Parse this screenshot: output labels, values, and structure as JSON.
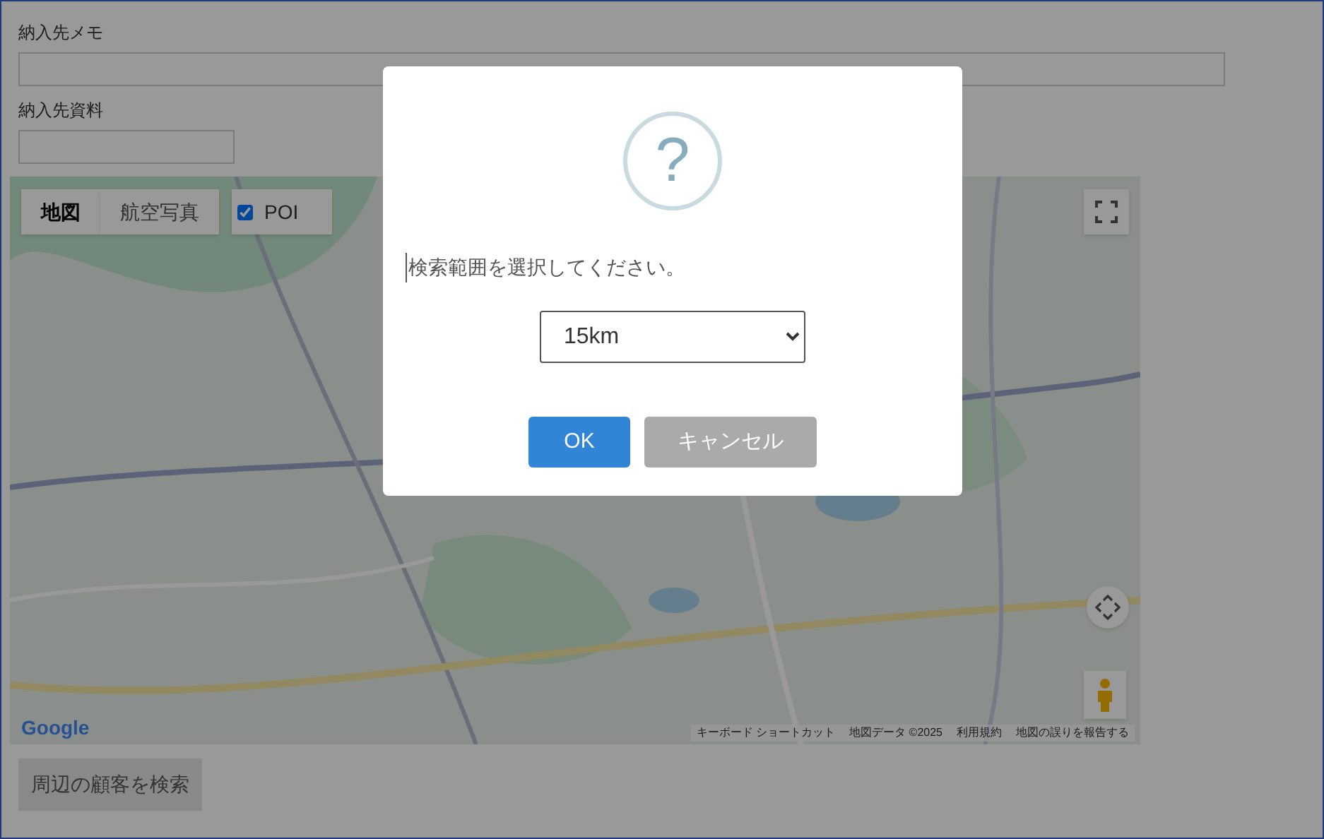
{
  "form": {
    "fields": [
      {
        "label": "納入先メモ",
        "kind": "wide"
      },
      {
        "label": "納入先資料",
        "kind": "narrow"
      }
    ]
  },
  "map": {
    "tabs": [
      {
        "label": "地図",
        "selected": true
      },
      {
        "label": "航空写真",
        "selected": false
      }
    ],
    "poi": {
      "label": "POI",
      "checked": true
    },
    "logo": "Google",
    "attribution": [
      "キーボード ショートカット",
      "地図データ ©2025",
      "利用規約",
      "地図の誤りを報告する"
    ]
  },
  "search_button": {
    "label": "周辺の顧客を検索",
    "disabled": true
  },
  "dialog": {
    "icon_text": "?",
    "prompt": "検索範囲を選択してください。",
    "select": {
      "value": "15km"
    },
    "buttons": [
      {
        "label": "OK",
        "kind": "confirm"
      },
      {
        "label": "キャンセル",
        "kind": "cancel"
      }
    ]
  }
}
